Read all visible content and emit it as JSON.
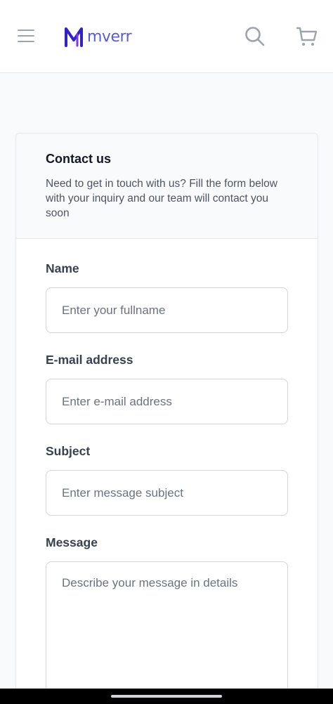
{
  "header": {
    "logo_text": "mverr",
    "logo_color": "#3b2fc9"
  },
  "contact": {
    "title": "Contact us",
    "description": "Need to get in touch with us? Fill the form below with your inquiry and our team will contact you soon"
  },
  "form": {
    "name": {
      "label": "Name",
      "placeholder": "Enter your fullname"
    },
    "email": {
      "label": "E-mail address",
      "placeholder": "Enter e-mail address"
    },
    "subject": {
      "label": "Subject",
      "placeholder": "Enter message subject"
    },
    "message": {
      "label": "Message",
      "placeholder": "Describe your message in details"
    }
  },
  "icons": [
    "menu-icon",
    "logo-icon",
    "search-icon",
    "cart-icon"
  ]
}
